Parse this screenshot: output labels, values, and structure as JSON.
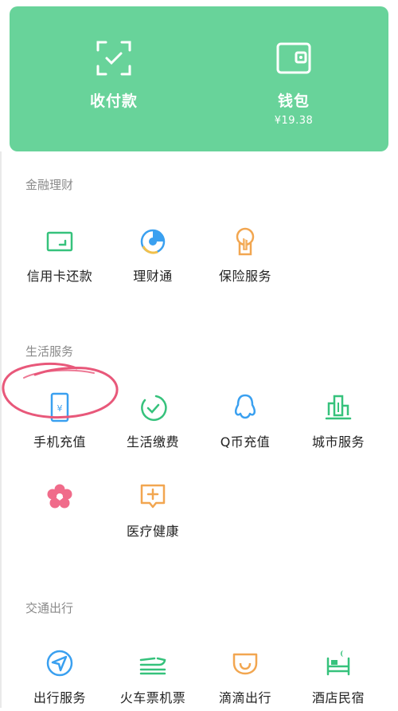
{
  "top_card": {
    "pay": {
      "label": "收付款",
      "icon": "scan-pay-icon"
    },
    "wallet": {
      "label": "钱包",
      "balance": "¥19.38",
      "icon": "wallet-icon"
    }
  },
  "finance": {
    "title": "金融理财",
    "items": [
      {
        "label": "信用卡还款",
        "icon": "credit-card-icon"
      },
      {
        "label": "理财通",
        "icon": "wealth-icon"
      },
      {
        "label": "保险服务",
        "icon": "insurance-icon"
      }
    ]
  },
  "life": {
    "title": "生活服务",
    "items": [
      {
        "label": "手机充值",
        "icon": "phone-icon"
      },
      {
        "label": "生活缴费",
        "icon": "utility-icon"
      },
      {
        "label": "Q币充值",
        "icon": "qq-icon"
      },
      {
        "label": "城市服务",
        "icon": "city-icon"
      },
      {
        "label": "",
        "icon": "flower-icon"
      },
      {
        "label": "医疗健康",
        "icon": "medical-icon"
      }
    ]
  },
  "transport": {
    "title": "交通出行",
    "items": [
      {
        "label": "出行服务",
        "icon": "navigation-icon"
      },
      {
        "label": "火车票机票",
        "icon": "train-icon"
      },
      {
        "label": "滴滴出行",
        "icon": "didi-icon"
      },
      {
        "label": "酒店民宿",
        "icon": "hotel-icon"
      }
    ]
  },
  "colors": {
    "card": "#68D39A",
    "green": "#36C27C",
    "blue": "#3AA0F0",
    "orange": "#F2A650",
    "pink": "#F06B8A",
    "annotation": "#E8587A"
  }
}
